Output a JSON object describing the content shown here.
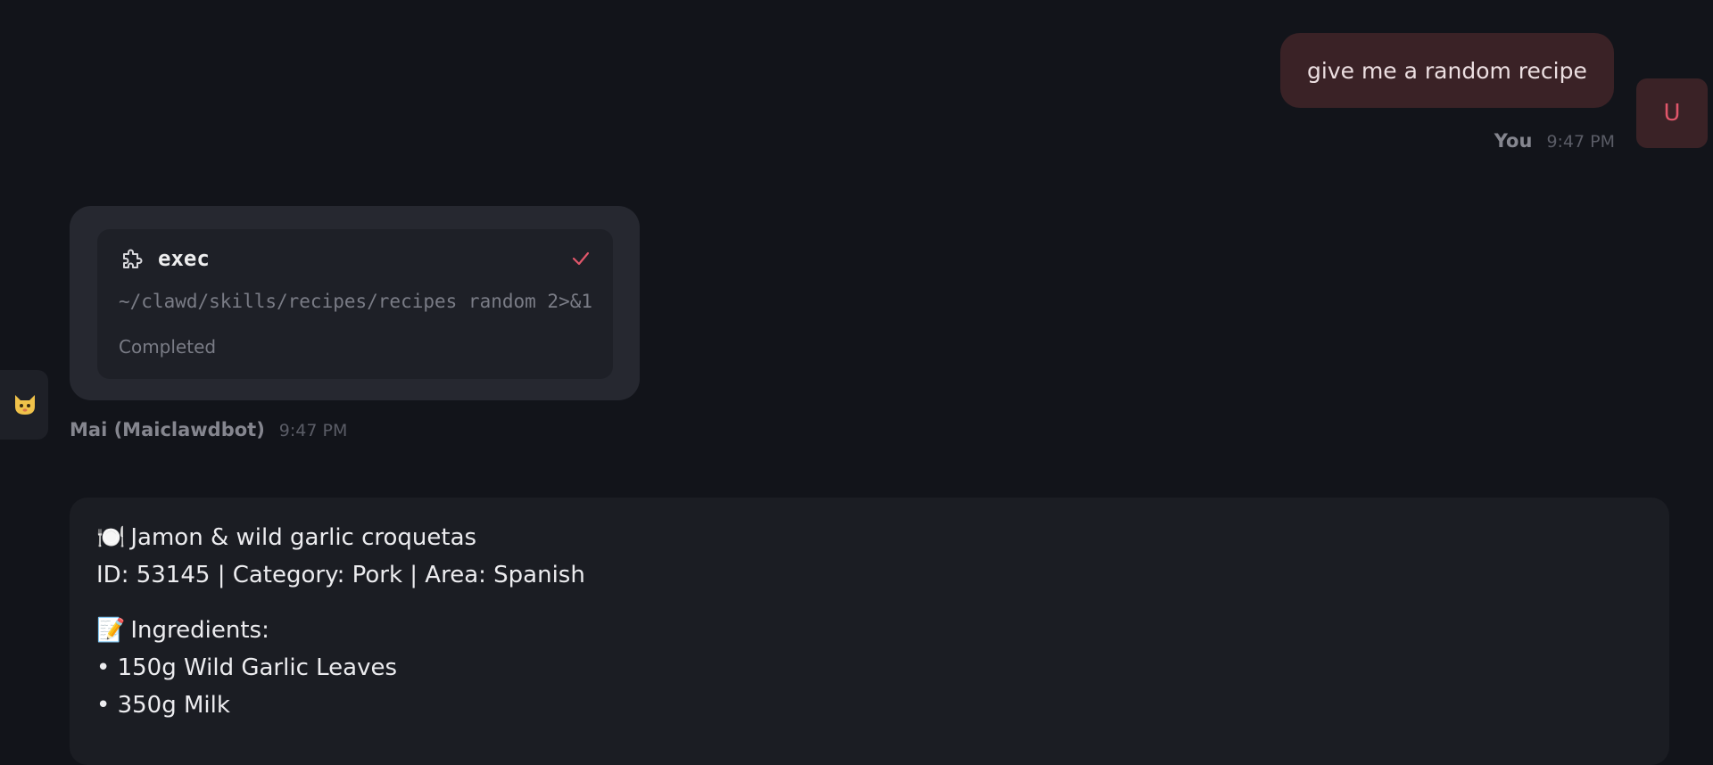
{
  "user_message": {
    "text": "give me a random recipe",
    "sender": "You",
    "time": "9:47 PM",
    "avatar_letter": "U"
  },
  "tool_call": {
    "name": "exec",
    "icon": "puzzle-icon",
    "command": "~/clawd/skills/recipes/recipes random 2>&1",
    "status": "Completed",
    "sender": "Mai (Maiclawdbot)",
    "time": "9:47 PM"
  },
  "bot_avatar": {
    "icon": "cat-icon"
  },
  "recipe": {
    "title_emoji": "🍽️",
    "title": "Jamon & wild garlic croquetas",
    "details": "ID: 53145 | Category: Pork | Area: Spanish",
    "ingredients_emoji": "📝",
    "ingredients_label": "Ingredients:",
    "ingredients": [
      "• 150g Wild Garlic Leaves",
      "• 350g Milk"
    ]
  },
  "colors": {
    "background": "#12141a",
    "user_bubble": "#3a2226",
    "accent": "#e0566a",
    "card": "#1b1d23"
  }
}
